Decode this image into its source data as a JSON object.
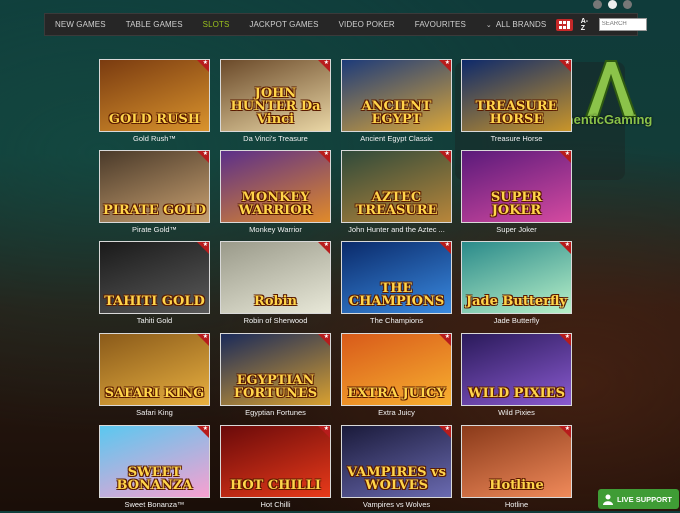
{
  "nav": {
    "tabs": [
      {
        "label": "NEW GAMES",
        "active": false
      },
      {
        "label": "TABLE GAMES",
        "active": false
      },
      {
        "label": "SLOTS",
        "active": true
      },
      {
        "label": "JACKPOT GAMES",
        "active": false
      },
      {
        "label": "VIDEO POKER",
        "active": false
      },
      {
        "label": "FAVOURITES",
        "active": false
      },
      {
        "label": "ALL BRANDS",
        "active": false
      }
    ],
    "sort_label": "A-Z",
    "search_placeholder": "SEARCH"
  },
  "carousel": {
    "dots": 3,
    "active_index": 1
  },
  "brand": {
    "logo_text": "AuthenticGaming",
    "logo_letter": "A"
  },
  "games": [
    {
      "name": "Gold Rush™",
      "art": "GOLD RUSH",
      "colors": [
        "#7a3b10",
        "#d9932d"
      ]
    },
    {
      "name": "Da Vinci's Treasure",
      "art": "JOHN HUNTER Da Vinci",
      "colors": [
        "#6b4a2a",
        "#e9d6a5"
      ]
    },
    {
      "name": "Ancient Egypt Classic",
      "art": "ANCIENT EGYPT",
      "colors": [
        "#1d3b7a",
        "#d8a53a"
      ]
    },
    {
      "name": "Treasure Horse",
      "art": "TREASURE HORSE",
      "colors": [
        "#0e2a6b",
        "#c9952a"
      ]
    },
    {
      "name": "Pirate Gold™",
      "art": "PIRATE GOLD",
      "colors": [
        "#4a3a2a",
        "#c8a070"
      ]
    },
    {
      "name": "Monkey Warrior",
      "art": "MONKEY WARRIOR",
      "colors": [
        "#5b2f8a",
        "#e08a2a"
      ]
    },
    {
      "name": "John Hunter and the Aztec ...",
      "art": "AZTEC TREASURE",
      "colors": [
        "#2f4a3a",
        "#b8863a"
      ]
    },
    {
      "name": "Super Joker",
      "art": "SUPER JOKER",
      "colors": [
        "#5a1a7a",
        "#d44aa0"
      ]
    },
    {
      "name": "Tahiti Gold",
      "art": "TAHITI GOLD",
      "colors": [
        "#1a1a1a",
        "#5a5a5a"
      ]
    },
    {
      "name": "Robin of Sherwood",
      "art": "Robin",
      "colors": [
        "#9a9a8a",
        "#e8e8d8"
      ]
    },
    {
      "name": "The Champions",
      "art": "THE CHAMPIONS",
      "colors": [
        "#0a2a6a",
        "#3a8ae0"
      ]
    },
    {
      "name": "Jade Butterfly",
      "art": "Jade Butterfly",
      "colors": [
        "#2a8a8a",
        "#b8f0c8"
      ]
    },
    {
      "name": "Safari King",
      "art": "SAFARI KING",
      "colors": [
        "#8a5a1a",
        "#e8b040"
      ]
    },
    {
      "name": "Egyptian Fortunes",
      "art": "EGYPTIAN FORTUNES",
      "colors": [
        "#1a2a5a",
        "#d8a030"
      ]
    },
    {
      "name": "Extra Juicy",
      "art": "EXTRA JUICY",
      "colors": [
        "#d85a1a",
        "#f8b030"
      ]
    },
    {
      "name": "Wild Pixies",
      "art": "WILD PIXIES",
      "colors": [
        "#2a1a5a",
        "#8a5ad0"
      ]
    },
    {
      "name": "Sweet Bonanza™",
      "art": "SWEET BONANZA",
      "colors": [
        "#5ac8f0",
        "#f8a0d0"
      ]
    },
    {
      "name": "Hot Chilli",
      "art": "HOT CHILLI",
      "colors": [
        "#6a0a0a",
        "#e83a1a"
      ]
    },
    {
      "name": "Vampires vs Wolves",
      "art": "VAMPIRES vs WOLVES",
      "colors": [
        "#1a1a3a",
        "#6a6ab0"
      ]
    },
    {
      "name": "Hotline",
      "art": "Hotline",
      "colors": [
        "#8a3a1a",
        "#f08a5a"
      ]
    }
  ],
  "live_support": {
    "label": "LIVE SUPPORT"
  }
}
